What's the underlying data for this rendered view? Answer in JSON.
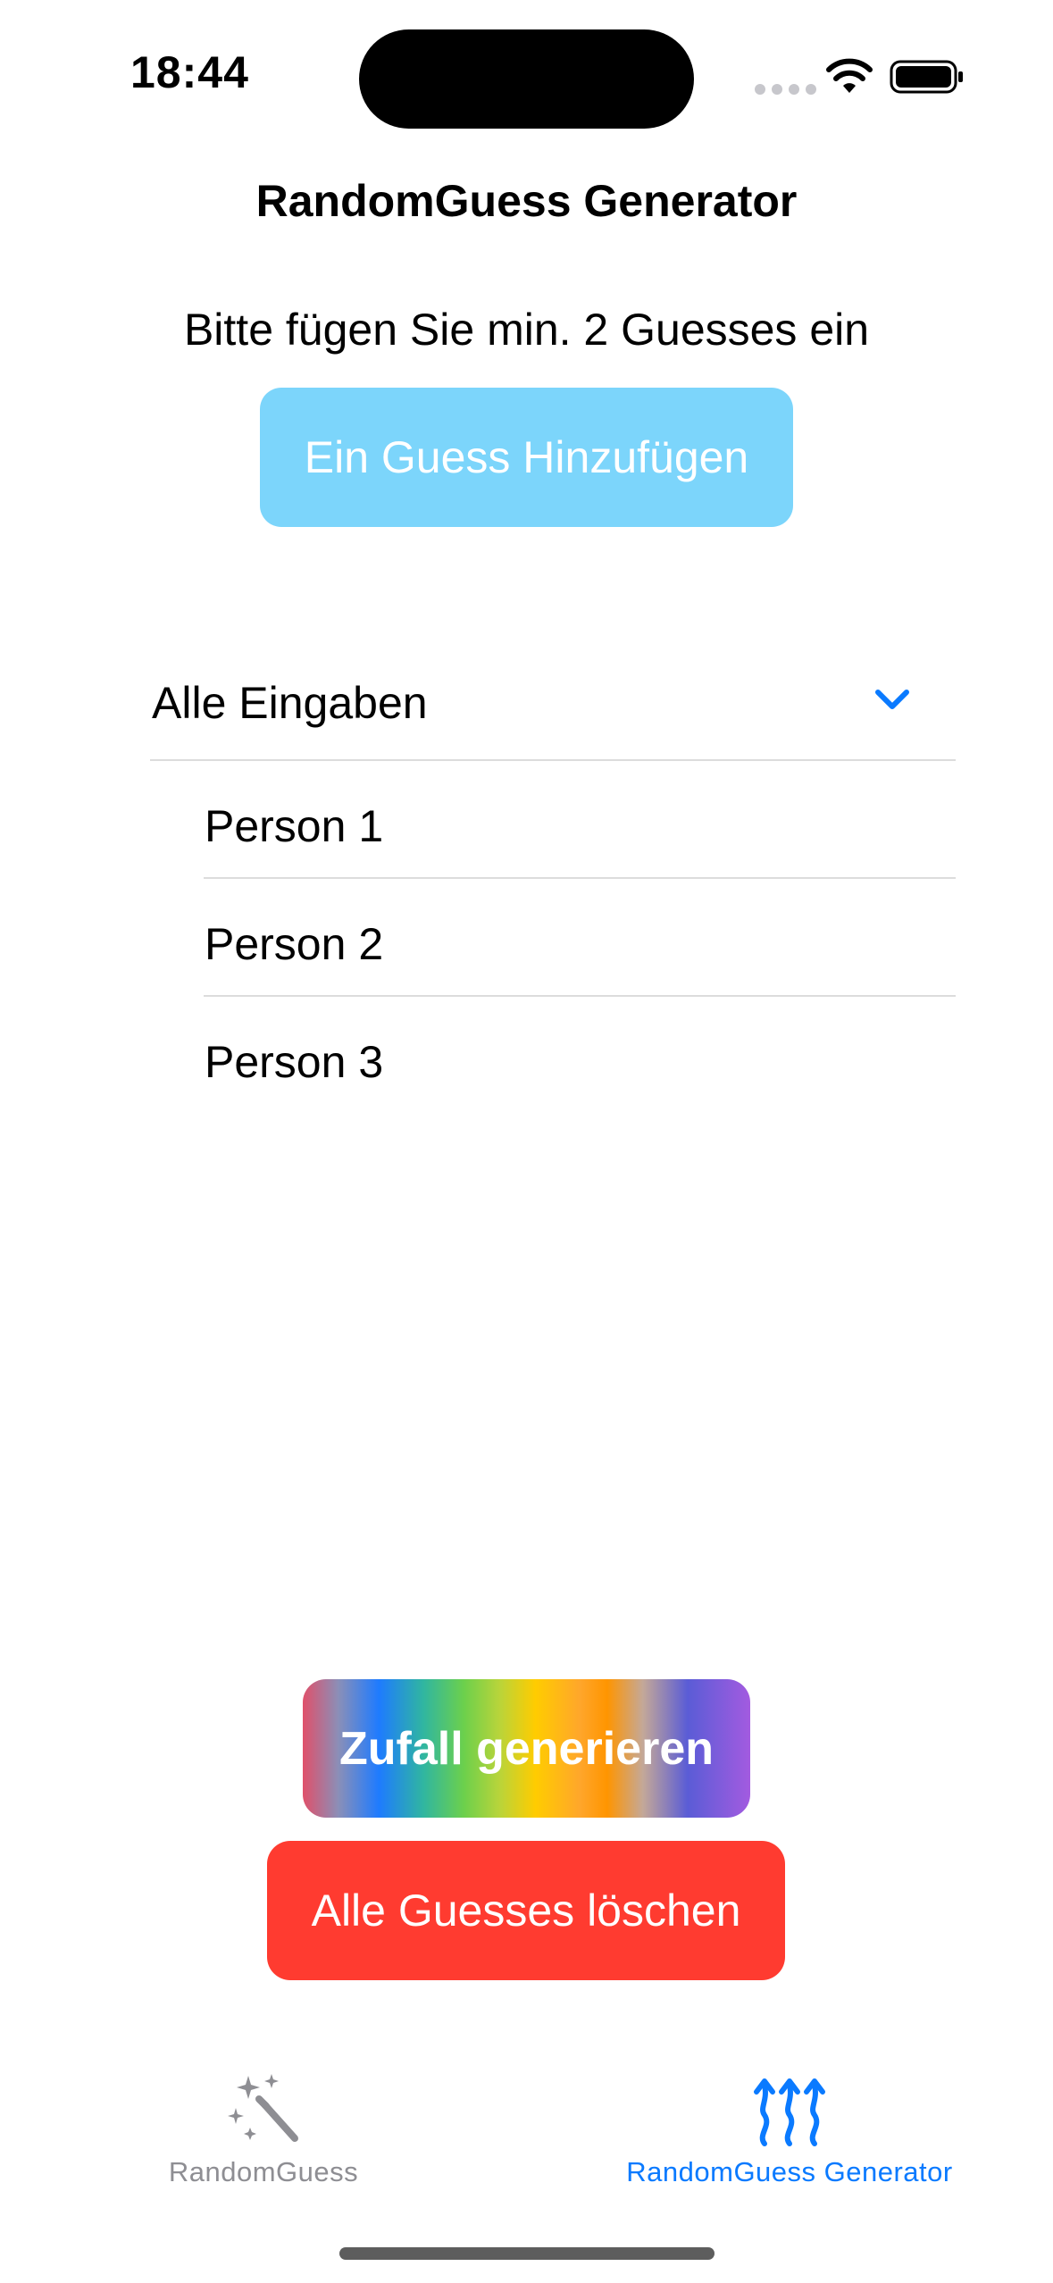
{
  "status_bar": {
    "time": "18:44"
  },
  "nav": {
    "title": "RandomGuess Generator"
  },
  "main": {
    "instruction": "Bitte fügen Sie min. 2 Guesses ein",
    "add_button_label": "Ein Guess Hinzufügen",
    "list": {
      "header_label": "Alle Eingaben",
      "expanded": true,
      "items": [
        {
          "label": "Person 1"
        },
        {
          "label": "Person 2"
        },
        {
          "label": "Person 3"
        }
      ]
    },
    "generate_button_label": "Zufall generieren",
    "delete_button_label": "Alle Guesses löschen"
  },
  "tab_bar": {
    "tabs": [
      {
        "label": "RandomGuess",
        "icon": "magic-wand-icon",
        "selected": false
      },
      {
        "label": "RandomGuess Generator",
        "icon": "arrows-up-icon",
        "selected": true
      }
    ]
  },
  "colors": {
    "accent": "#0a7aff",
    "add_button": "#76d3fb",
    "delete_button": "#ff3b30",
    "inactive_tab": "#8e8e93"
  }
}
